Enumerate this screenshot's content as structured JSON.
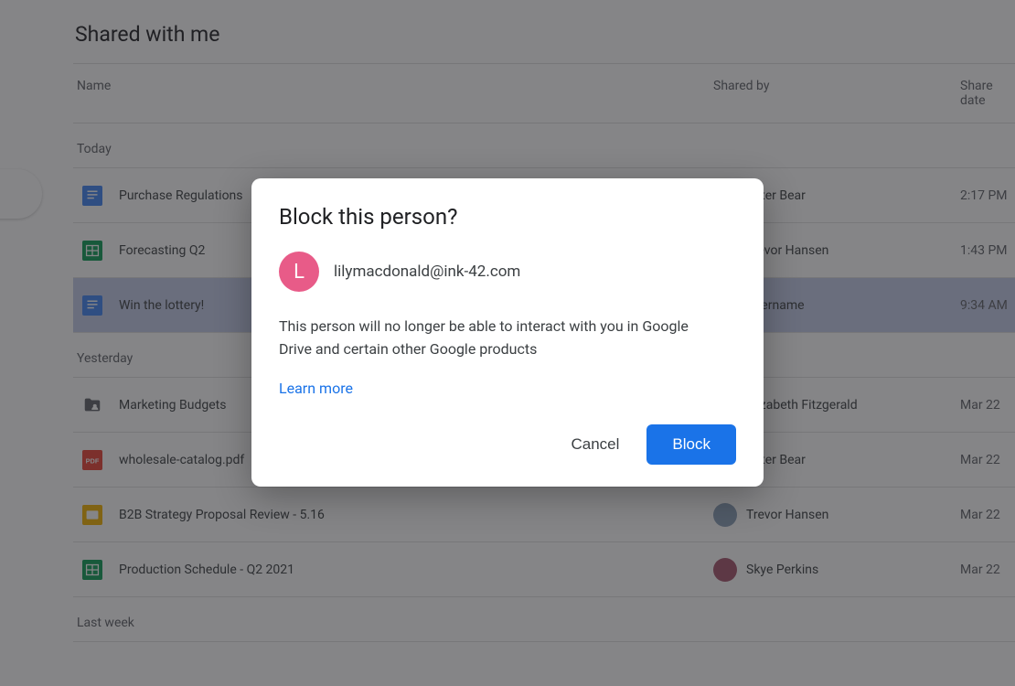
{
  "page": {
    "title": "Shared with me",
    "columns": {
      "name": "Name",
      "sharedBy": "Shared by",
      "shareDate": "Share date"
    }
  },
  "sections": [
    {
      "label": "Today",
      "rows": [
        {
          "icon": "docs",
          "name": "Purchase Regulations",
          "sharedBy": "Peter Bear",
          "date": "2:17 PM",
          "selected": false,
          "avatar": "bear"
        },
        {
          "icon": "sheets",
          "name": "Forecasting Q2",
          "sharedBy": "Trevor Hansen",
          "date": "1:43 PM",
          "selected": false,
          "avatar": "trevor"
        },
        {
          "icon": "docs",
          "name": "Win the lottery!",
          "sharedBy": "Username",
          "date": "9:34 AM",
          "selected": true,
          "avatar": "user"
        }
      ]
    },
    {
      "label": "Yesterday",
      "rows": [
        {
          "icon": "folder",
          "name": "Marketing Budgets",
          "sharedBy": "Elizabeth Fitzgerald",
          "date": "Mar 22",
          "selected": false,
          "avatar": "liz"
        },
        {
          "icon": "pdf",
          "name": "wholesale-catalog.pdf",
          "sharedBy": "Peter Bear",
          "date": "Mar 22",
          "selected": false,
          "avatar": "bear"
        },
        {
          "icon": "slides",
          "name": "B2B Strategy Proposal Review - 5.16",
          "sharedBy": "Trevor Hansen",
          "date": "Mar 22",
          "selected": false,
          "avatar": "trevor"
        },
        {
          "icon": "sheets",
          "name": "Production Schedule - Q2 2021",
          "sharedBy": "Skye Perkins",
          "date": "Mar 22",
          "selected": false,
          "avatar": "skye"
        }
      ]
    },
    {
      "label": "Last week",
      "rows": []
    }
  ],
  "dialog": {
    "title": "Block this person?",
    "avatarInitial": "L",
    "email": "lilymacdonald@ink-42.com",
    "body": "This person will no longer be able to interact with you in Google Drive and certain other Google products",
    "learnMore": "Learn more",
    "cancel": "Cancel",
    "block": "Block"
  },
  "iconColors": {
    "docs": "#4285f4",
    "sheets": "#0f9d58",
    "slides": "#f4b400",
    "pdf": "#ea4335",
    "folder": "#5f6368"
  }
}
